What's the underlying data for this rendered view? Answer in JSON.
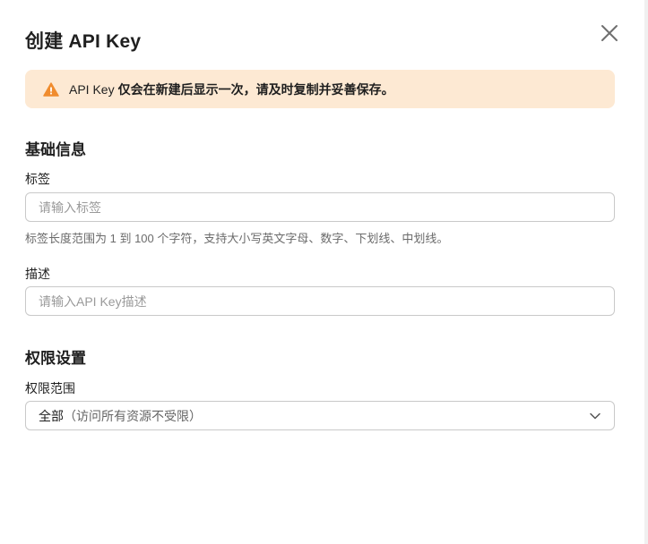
{
  "dialog": {
    "title": "创建 API Key"
  },
  "alert": {
    "prefix": "API Key",
    "message": "仅会在新建后显示一次，请及时复制并妥善保存。"
  },
  "basic_info": {
    "section_title": "基础信息",
    "tag": {
      "label": "标签",
      "placeholder": "请输入标签",
      "value": "",
      "hint": "标签长度范围为 1 到 100 个字符，支持大小写英文字母、数字、下划线、中划线。"
    },
    "description": {
      "label": "描述",
      "placeholder": "请输入API Key描述",
      "value": ""
    }
  },
  "permissions": {
    "section_title": "权限设置",
    "scope": {
      "label": "权限范围",
      "selected_value": "全部",
      "selected_desc": "（访问所有资源不受限）"
    }
  },
  "colors": {
    "alert_bg": "#fde9d3",
    "warning_icon": "#f08c2e",
    "border": "#c9c9c9"
  },
  "icons": {
    "close": "close-icon",
    "warning": "warning-icon",
    "dropdown": "chevron-down-icon"
  }
}
